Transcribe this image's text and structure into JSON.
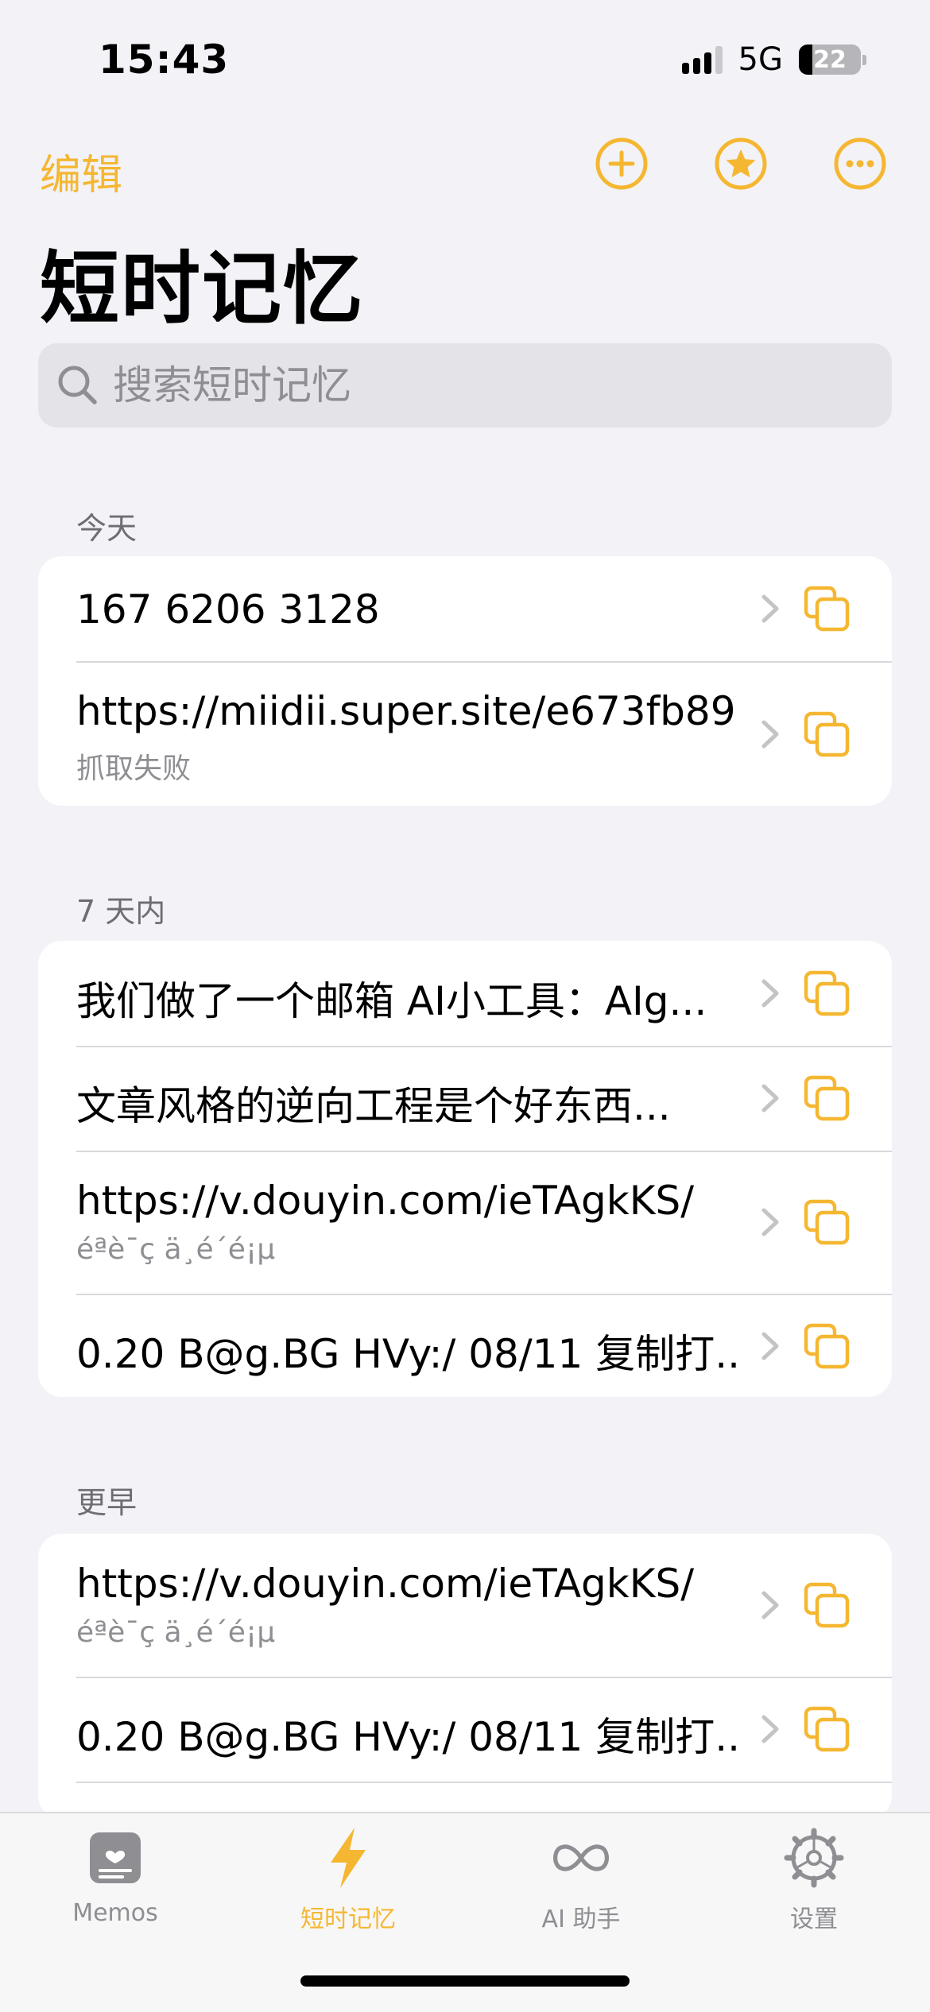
{
  "status_bar": {
    "time": "15:43",
    "network": "5G",
    "battery": "22"
  },
  "nav": {
    "edit_label": "编辑",
    "title": "短时记忆",
    "add_icon": "plus-circle-icon",
    "favorites_icon": "star-circle-icon",
    "more_icon": "ellipsis-circle-icon"
  },
  "search": {
    "placeholder": "搜索短时记忆",
    "value": ""
  },
  "sections": [
    {
      "header": "今天",
      "items": [
        {
          "title": "167 6206 3128",
          "subtitle": ""
        },
        {
          "title": "https://miidii.super.site/e673fb89...",
          "subtitle": "抓取失败"
        }
      ]
    },
    {
      "header": "7 天内",
      "items": [
        {
          "title": "我们做了一个邮箱 AI小工具：AIg...",
          "subtitle": ""
        },
        {
          "title": "文章风格的逆向工程是个好东西...",
          "subtitle": ""
        },
        {
          "title": "https://v.douyin.com/ieTAgkKS/",
          "subtitle": "éªè¯ç ä¸é´é¡µ"
        },
        {
          "title": "0.20 B@g.BG HVy:/ 08/11 复制打...",
          "subtitle": ""
        }
      ]
    },
    {
      "header": "更早",
      "items": [
        {
          "title": "https://v.douyin.com/ieTAgkKS/",
          "subtitle": "éªè¯ç ä¸é´é¡µ"
        },
        {
          "title": "0.20 B@g.BG HVy:/ 08/11 复制打...",
          "subtitle": ""
        }
      ]
    }
  ],
  "tabs": [
    {
      "label": "Memos",
      "icon": "memo-note-icon",
      "active": false
    },
    {
      "label": "短时记忆",
      "icon": "lightning-bolt-icon",
      "active": true
    },
    {
      "label": "AI 助手",
      "icon": "infinity-icon",
      "active": false
    },
    {
      "label": "设置",
      "icon": "gear-icon",
      "active": false
    }
  ],
  "colors": {
    "accent": "#F5B731",
    "background": "#F2F2F7",
    "card": "#FFFFFF",
    "secondary_text": "#8E8E93"
  }
}
